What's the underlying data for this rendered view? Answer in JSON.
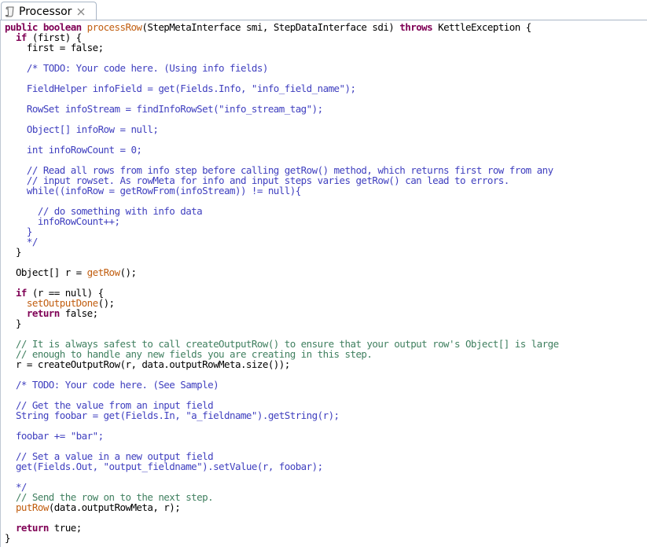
{
  "tab": {
    "title": "Processor",
    "icon": "script-icon",
    "close_icon": "close-icon"
  },
  "code": [
    [
      [
        "kw",
        "public boolean "
      ],
      [
        "fn",
        "processRow"
      ],
      [
        "pl",
        "(StepMetaInterface smi, StepDataInterface sdi) "
      ],
      [
        "kw",
        "throws"
      ],
      [
        "pl",
        " KettleException {"
      ]
    ],
    [
      [
        "pl",
        "  "
      ],
      [
        "kw",
        "if"
      ],
      [
        "pl",
        " (first) {"
      ]
    ],
    [
      [
        "pl",
        "    first = false;"
      ]
    ],
    [],
    [
      [
        "dc",
        "    /* TODO: Your code here. (Using info fields)"
      ]
    ],
    [],
    [
      [
        "dc",
        "    FieldHelper infoField = get(Fields.Info, \"info_field_name\");"
      ]
    ],
    [],
    [
      [
        "dc",
        "    RowSet infoStream = findInfoRowSet(\"info_stream_tag\");"
      ]
    ],
    [],
    [
      [
        "dc",
        "    Object[] infoRow = null;"
      ]
    ],
    [],
    [
      [
        "dc",
        "    int infoRowCount = 0;"
      ]
    ],
    [],
    [
      [
        "dc",
        "    // Read all rows from info step before calling getRow() method, which returns first row from any"
      ]
    ],
    [
      [
        "dc",
        "    // input rowset. As rowMeta for info and input steps varies getRow() can lead to errors."
      ]
    ],
    [
      [
        "dc",
        "    while((infoRow = getRowFrom(infoStream)) != null){"
      ]
    ],
    [],
    [
      [
        "dc",
        "      // do something with info data"
      ]
    ],
    [
      [
        "dc",
        "      infoRowCount++;"
      ]
    ],
    [
      [
        "dc",
        "    }"
      ]
    ],
    [
      [
        "dc",
        "    */"
      ]
    ],
    [
      [
        "pl",
        "  }"
      ]
    ],
    [],
    [
      [
        "pl",
        "  Object[] r = "
      ],
      [
        "fn",
        "getRow"
      ],
      [
        "pl",
        "();"
      ]
    ],
    [],
    [
      [
        "pl",
        "  "
      ],
      [
        "kw",
        "if"
      ],
      [
        "pl",
        " (r == null) {"
      ]
    ],
    [
      [
        "pl",
        "    "
      ],
      [
        "fn",
        "setOutputDone"
      ],
      [
        "pl",
        "();"
      ]
    ],
    [
      [
        "pl",
        "    "
      ],
      [
        "kw",
        "return"
      ],
      [
        "pl",
        " false;"
      ]
    ],
    [
      [
        "pl",
        "  }"
      ]
    ],
    [],
    [
      [
        "cm",
        "  // It is always safest to call createOutputRow() to ensure that your output row's Object[] is large"
      ]
    ],
    [
      [
        "cm",
        "  // enough to handle any new fields you are creating in this step."
      ]
    ],
    [
      [
        "pl",
        "  r = createOutputRow(r, data.outputRowMeta.size());"
      ]
    ],
    [],
    [
      [
        "dc",
        "  /* TODO: Your code here. (See Sample)"
      ]
    ],
    [],
    [
      [
        "dc",
        "  // Get the value from an input field"
      ]
    ],
    [
      [
        "dc",
        "  String foobar = get(Fields.In, \"a_fieldname\").getString(r);"
      ]
    ],
    [],
    [
      [
        "dc",
        "  foobar += \"bar\";"
      ]
    ],
    [],
    [
      [
        "dc",
        "  // Set a value in a new output field"
      ]
    ],
    [
      [
        "dc",
        "  get(Fields.Out, \"output_fieldname\").setValue(r, foobar);"
      ]
    ],
    [],
    [
      [
        "dc",
        "  */"
      ]
    ],
    [
      [
        "cm",
        "  // Send the row on to the next step."
      ]
    ],
    [
      [
        "pl",
        "  "
      ],
      [
        "fn",
        "putRow"
      ],
      [
        "pl",
        "(data.outputRowMeta, r);"
      ]
    ],
    [],
    [
      [
        "pl",
        "  "
      ],
      [
        "kw",
        "return"
      ],
      [
        "pl",
        " true;"
      ]
    ],
    [
      [
        "pl",
        "}"
      ]
    ]
  ]
}
